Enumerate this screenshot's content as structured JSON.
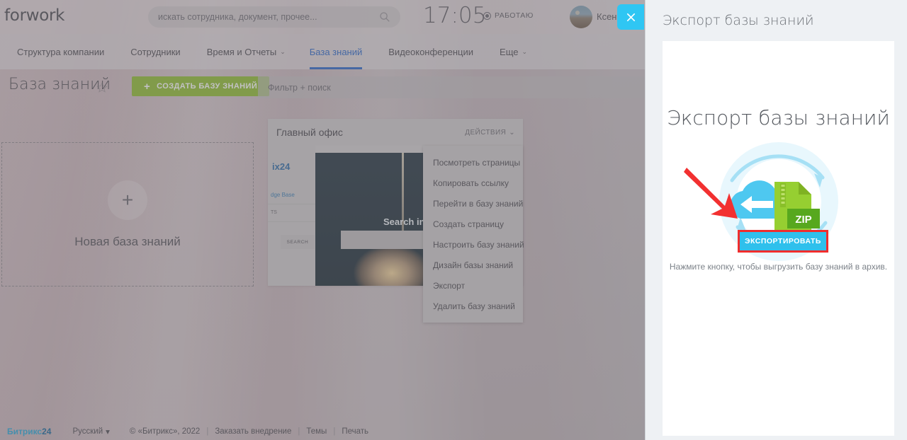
{
  "topbar": {
    "logo": "forwork",
    "search_placeholder": "искать сотрудника, документ, прочее...",
    "search_icon": "search-icon",
    "clock": "17:05",
    "work_status": "РАБОТАЮ",
    "username": "Ксен",
    "close_icon": "close-icon"
  },
  "nav": {
    "items": [
      {
        "label": "Структура компании",
        "caret": "",
        "active": false
      },
      {
        "label": "Сотрудники",
        "caret": "",
        "active": false
      },
      {
        "label": "Время и Отчеты",
        "caret": "⌄",
        "active": false
      },
      {
        "label": "База знаний",
        "caret": "",
        "active": true
      },
      {
        "label": "Видеоконференции",
        "caret": "",
        "active": false
      },
      {
        "label": "Еще",
        "caret": "⌄",
        "active": false
      }
    ]
  },
  "page": {
    "title": "База знаний",
    "favorite_icon": "star-icon",
    "create_button": "СОЗДАТЬ БАЗУ ЗНАНИЙ",
    "create_button_plus": "+",
    "create_button_color": "#8fbd2f",
    "filter_placeholder": "Фильтр + поиск"
  },
  "new_kb_card": {
    "plus": "+",
    "label": "Новая база знаний"
  },
  "kb_card": {
    "title": "Главный офис",
    "actions_label": "ДЕЙСТВИЯ",
    "actions_caret": "⌄",
    "preview": {
      "logo_text": "ix24",
      "menu_1": "dge Base",
      "menu_2": "TS",
      "search_button": "SEARCH",
      "hero_title": "Search in"
    }
  },
  "kb_menu": {
    "items": [
      "Посмотреть страницы",
      "Копировать ссылку",
      "Перейти в базу знаний",
      "Создать страницу",
      "Настроить базу знаний",
      "Дизайн базы знаний",
      "Экспорт",
      "Удалить базу знаний"
    ]
  },
  "footer": {
    "brand": "Битрикс",
    "brand_num": "24",
    "language": "Русский",
    "language_caret": "▾",
    "copyright": "© «Битрикс», 2022",
    "links": [
      "Заказать внедрение",
      "Темы",
      "Печать"
    ],
    "separator": "|"
  },
  "slider": {
    "header_title": "Экспорт базы знаний",
    "heading": "Экспорт базы знаний",
    "icon_name": "cloud-zip-export-icon",
    "zip_label": "ZIP",
    "arrow_icon": "red-pointer-arrow-icon",
    "export_button": "ЭКСПОРТИРОВАТЬ",
    "export_button_color": "#2fc0ec",
    "highlight_color": "#f02d2d",
    "caption": "Нажмите кнопку, чтобы выгрузить базу знаний в архив."
  }
}
